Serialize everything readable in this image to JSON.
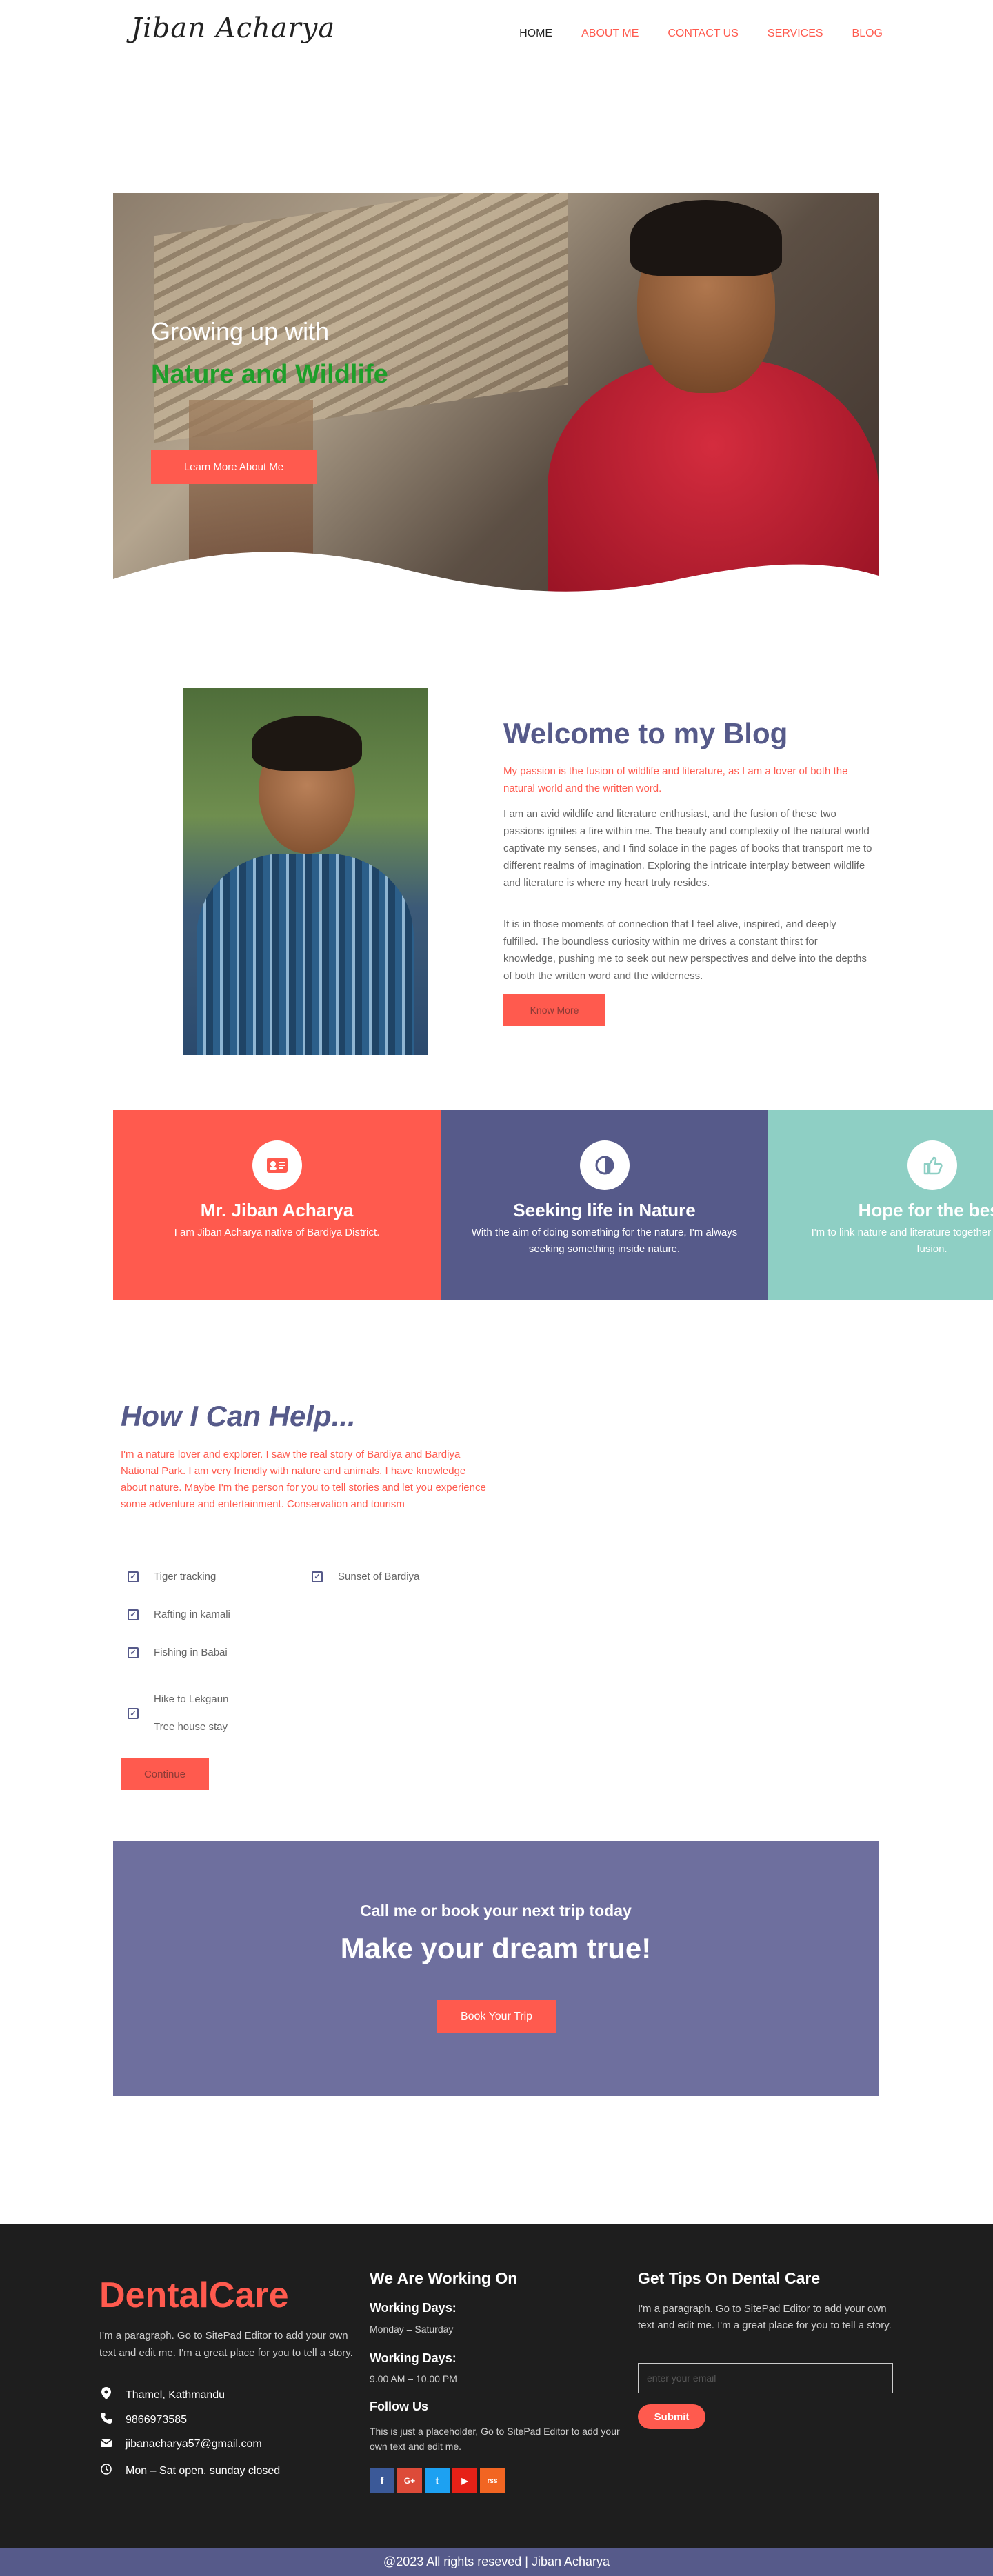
{
  "header": {
    "logo": "Jiban Acharya",
    "nav": [
      "HOME",
      "ABOUT ME",
      "CONTACT US",
      "SERVICES",
      "BLOG"
    ]
  },
  "hero": {
    "title_line1": "Growing up with",
    "title_line2": "Nature and Wildlife",
    "button": "Learn More About Me"
  },
  "welcome": {
    "title": "Welcome to my Blog",
    "subtitle": "My passion is the fusion of wildlife and literature, as I am a lover of both the natural world and the written word.",
    "paragraph1": "I am an avid wildlife and literature enthusiast, and the fusion of these two passions ignites a fire within me. The beauty and complexity of the natural world captivate my senses, and I find solace in the pages of books that transport me to different realms of imagination. Exploring the intricate interplay between wildlife and literature is where my heart truly resides.",
    "paragraph2": "It is in those moments of connection that I feel alive, inspired, and deeply fulfilled. The boundless curiosity within me drives a constant thirst for knowledge, pushing me to seek out new perspectives and delve into the depths of both the written word and the wilderness.",
    "button": "Know More"
  },
  "cards": [
    {
      "title": "Mr. Jiban Acharya",
      "text": "I am Jiban Acharya native of Bardiya District.",
      "icon": "id-card-icon"
    },
    {
      "title": "Seeking life in Nature",
      "text": "With the aim of doing something for the nature, I'm always seeking something inside nature.",
      "icon": "half-circle-icon"
    },
    {
      "title": "Hope for the best",
      "text": "I'm to link nature and literature together in a beautiful fusion.",
      "icon": "thumbs-up-icon"
    }
  ],
  "help": {
    "title": "How I Can Help...",
    "text": "I'm a nature lover and explorer. I saw the real story of Bardiya and Bardiya National Park. I am very friendly with nature and animals. I have knowledge about nature. Maybe I'm the person for you to tell stories and let you experience some adventure and entertainment. Conservation and tourism",
    "items_left": [
      "Tiger tracking",
      "Rafting in kamali",
      "Fishing in Babai",
      "Hike to Lekgaun",
      "Tree house stay"
    ],
    "items_right": [
      "Sunset of Bardiya"
    ],
    "button": "Continue"
  },
  "cta": {
    "subtitle": "Call me or book your next trip today",
    "title": "Make your dream true!",
    "button": "Book Your Trip"
  },
  "footer": {
    "brand": "DentalCare",
    "about": "I'm a paragraph. Go to SitePad Editor to add your own text and edit me. I'm a great place for you to tell a story.",
    "address": "Thamel, Kathmandu",
    "phone": "9866973585",
    "email": "jibanacharya57@gmail.com",
    "hours": "Mon – Sat open, sunday closed",
    "working_title": "We Are Working On",
    "working_days_label": "Working Days:",
    "working_days_value": "Monday – Saturday",
    "working_hours_label": "Working Days:",
    "working_hours_value": "9.00 AM – 10.00 PM",
    "follow_title": "Follow Us",
    "follow_text": "This is just a placeholder, Go to SitePad Editor to add your own text and edit me.",
    "socials": [
      "f",
      "G+",
      "t",
      "▶",
      "rss"
    ],
    "tips_title": "Get Tips On Dental Care",
    "tips_text": "I'm a paragraph. Go to SitePad Editor to add your own text and edit me. I'm a great place for you to tell a story.",
    "email_placeholder": "enter your email",
    "submit": "Submit",
    "copyright": "@2023 All rights reseved | Jiban Acharya"
  },
  "colors": {
    "accent": "#ff5a4e",
    "purple": "#565a8a",
    "teal": "#8ecfc4",
    "green": "#1e9e2a",
    "dark": "#1e1e1e"
  }
}
